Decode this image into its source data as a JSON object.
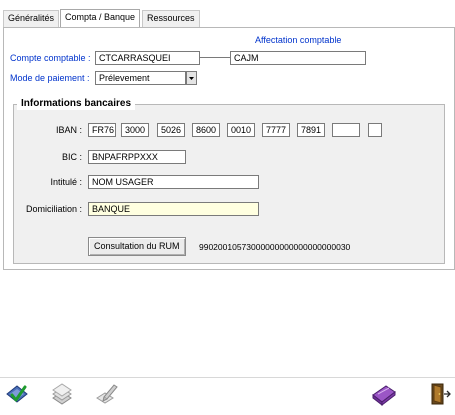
{
  "tabs": [
    {
      "label": "Généralités",
      "active": false
    },
    {
      "label": "Compta / Banque",
      "active": true
    },
    {
      "label": "Ressources",
      "active": false
    }
  ],
  "compta": {
    "affectation_label": "Affectation comptable",
    "compte_label": "Compte comptable :",
    "compte_value": "CTCARRASQUEI",
    "affectation_value": "CAJM",
    "mode_label": "Mode de paiement :",
    "mode_value": "Prélevement"
  },
  "bank": {
    "title": "Informations bancaires",
    "iban_label": "IBAN :",
    "iban_parts": [
      "FR76",
      "3000",
      "5026",
      "8600",
      "0010",
      "7777",
      "7891",
      "",
      ""
    ],
    "bic_label": "BIC :",
    "bic_value": "BNPAFRPPXXX",
    "intitule_label": "Intitulé :",
    "intitule_value": "NOM USAGER",
    "domiciliation_label": "Domiciliation :",
    "domiciliation_value": "BANQUE",
    "rum_button": "Consultation du RUM",
    "rum_value": "99020010573000000000000000000030"
  },
  "colors": {
    "label_blue": "#0033cc",
    "highlight_field": "#ffffe0"
  },
  "toolbar": {
    "icons": [
      "validate-icon",
      "stack-icon",
      "edit-icon",
      "eraser-icon",
      "exit-door-icon"
    ]
  }
}
